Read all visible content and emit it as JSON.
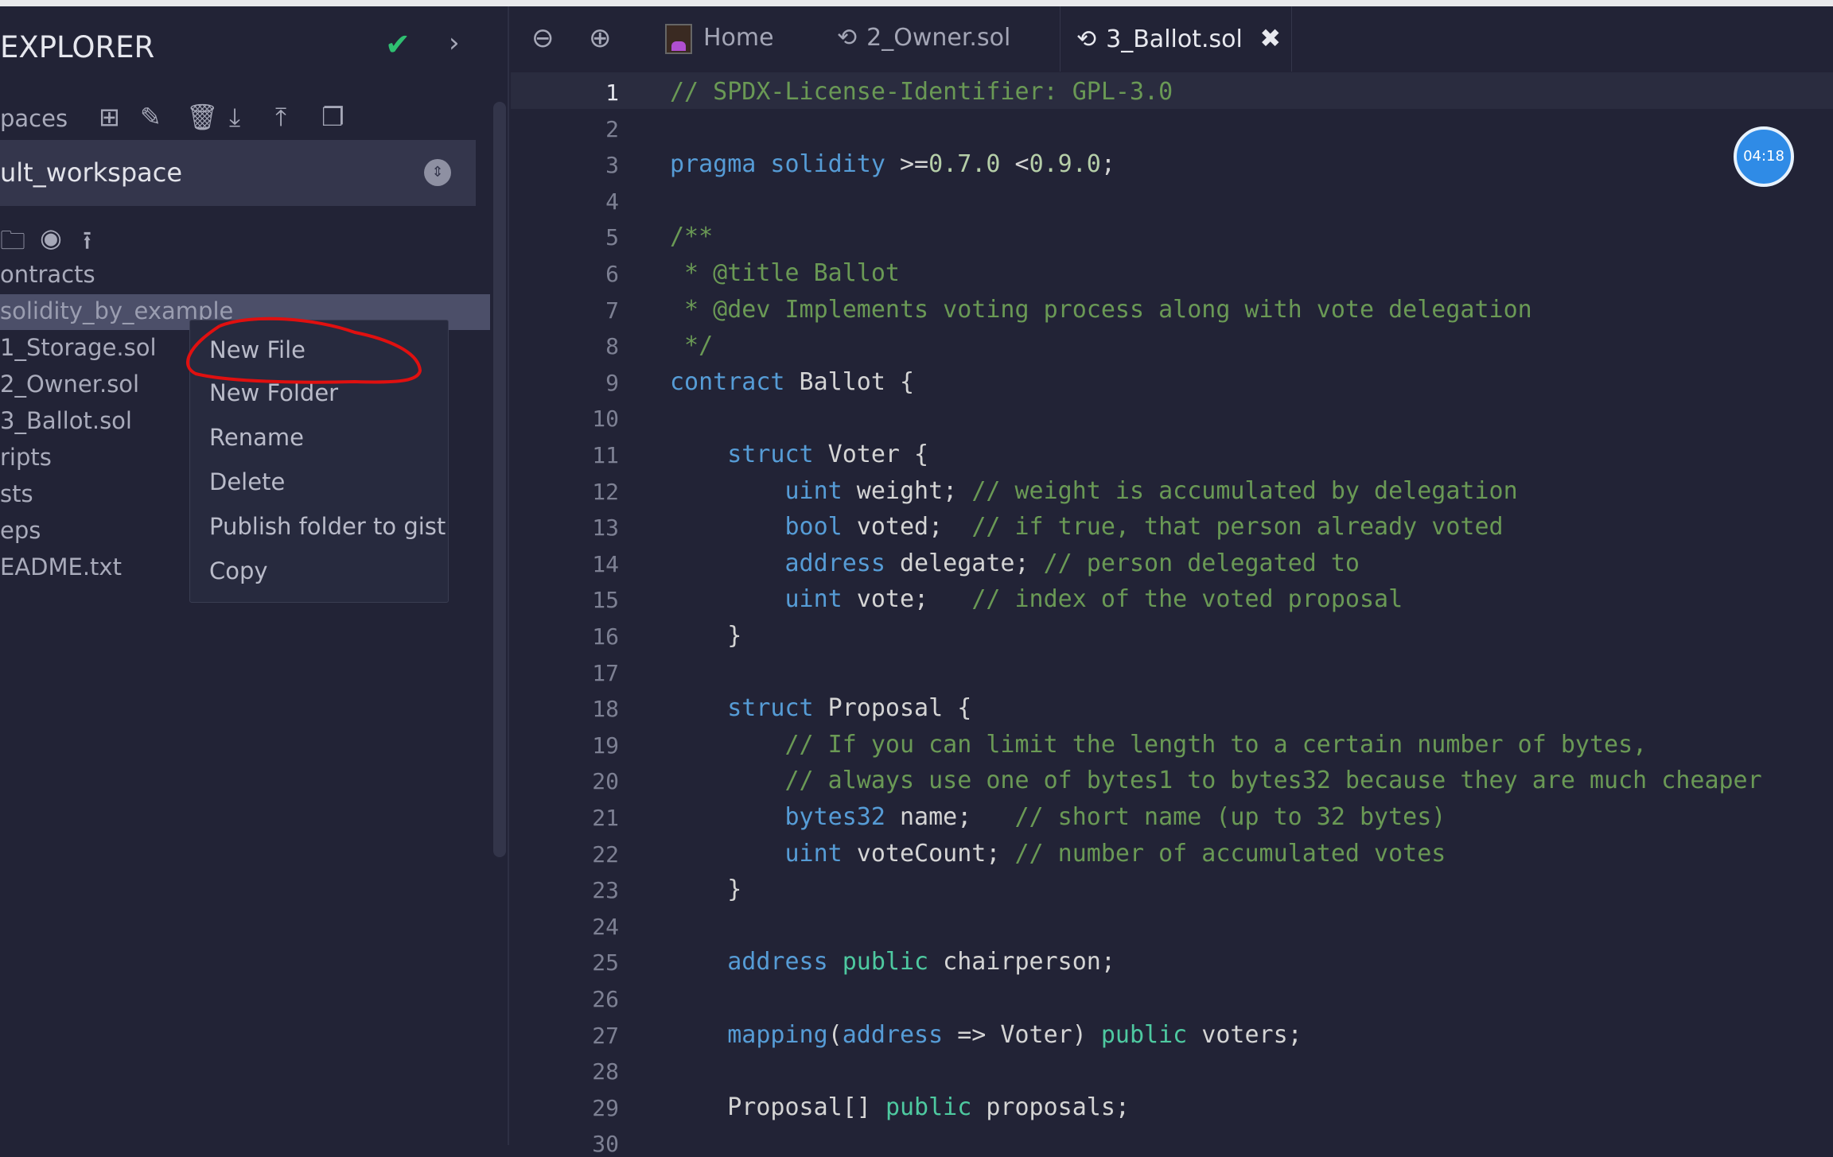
{
  "sidebar": {
    "title": "EXPLORER",
    "workspaces_label": "paces",
    "workspace_selected": "ult_workspace",
    "tree": [
      "ontracts",
      "solidity_by_example",
      "1_Storage.sol",
      "2_Owner.sol",
      "3_Ballot.sol",
      "ripts",
      "sts",
      "eps",
      "EADME.txt"
    ]
  },
  "context_menu": {
    "items": [
      "New File",
      "New Folder",
      "Rename",
      "Delete",
      "Publish folder to gist",
      "Copy"
    ]
  },
  "tabs": [
    {
      "label": "Home"
    },
    {
      "label": "2_Owner.sol"
    },
    {
      "label": "3_Ballot.sol",
      "active": true
    }
  ],
  "timer": "04:18",
  "annotation_color": "#e01010",
  "editor": {
    "current_line": 1,
    "lines": [
      [
        [
          "c",
          "// SPDX-License-Identifier: GPL-3.0"
        ]
      ],
      [],
      [
        [
          "k",
          "pragma solidity"
        ],
        [
          "t",
          " >="
        ],
        [
          "n",
          "0.7.0"
        ],
        [
          "t",
          " <"
        ],
        [
          "n",
          "0.9.0"
        ],
        [
          "t",
          ";"
        ]
      ],
      [],
      [
        [
          "c",
          "/**"
        ]
      ],
      [
        [
          "c",
          " * @title Ballot"
        ]
      ],
      [
        [
          "c",
          " * @dev Implements voting process along with vote delegation"
        ]
      ],
      [
        [
          "c",
          " */"
        ]
      ],
      [
        [
          "k",
          "contract"
        ],
        [
          "t",
          " Ballot {"
        ]
      ],
      [],
      [
        [
          "t",
          "    "
        ],
        [
          "k",
          "struct"
        ],
        [
          "t",
          " Voter {"
        ]
      ],
      [
        [
          "t",
          "        "
        ],
        [
          "k",
          "uint"
        ],
        [
          "t",
          " weight; "
        ],
        [
          "c",
          "// weight is accumulated by delegation"
        ]
      ],
      [
        [
          "t",
          "        "
        ],
        [
          "k",
          "bool"
        ],
        [
          "t",
          " voted;  "
        ],
        [
          "c",
          "// if true, that person already voted"
        ]
      ],
      [
        [
          "t",
          "        "
        ],
        [
          "k",
          "address"
        ],
        [
          "t",
          " delegate; "
        ],
        [
          "c",
          "// person delegated to"
        ]
      ],
      [
        [
          "t",
          "        "
        ],
        [
          "k",
          "uint"
        ],
        [
          "t",
          " vote;   "
        ],
        [
          "c",
          "// index of the voted proposal"
        ]
      ],
      [
        [
          "t",
          "    }"
        ]
      ],
      [],
      [
        [
          "t",
          "    "
        ],
        [
          "k",
          "struct"
        ],
        [
          "t",
          " Proposal {"
        ]
      ],
      [
        [
          "t",
          "        "
        ],
        [
          "c",
          "// If you can limit the length to a certain number of bytes,"
        ]
      ],
      [
        [
          "t",
          "        "
        ],
        [
          "c",
          "// always use one of bytes1 to bytes32 because they are much cheaper"
        ]
      ],
      [
        [
          "t",
          "        "
        ],
        [
          "k",
          "bytes32"
        ],
        [
          "t",
          " name;   "
        ],
        [
          "c",
          "// short name (up to 32 bytes)"
        ]
      ],
      [
        [
          "t",
          "        "
        ],
        [
          "k",
          "uint"
        ],
        [
          "t",
          " voteCount; "
        ],
        [
          "c",
          "// number of accumulated votes"
        ]
      ],
      [
        [
          "t",
          "    }"
        ]
      ],
      [],
      [
        [
          "t",
          "    "
        ],
        [
          "k",
          "address"
        ],
        [
          "t",
          " "
        ],
        [
          "g",
          "public"
        ],
        [
          "t",
          " chairperson;"
        ]
      ],
      [],
      [
        [
          "t",
          "    "
        ],
        [
          "k",
          "mapping"
        ],
        [
          "t",
          "("
        ],
        [
          "k",
          "address"
        ],
        [
          "t",
          " => Voter) "
        ],
        [
          "g",
          "public"
        ],
        [
          "t",
          " voters;"
        ]
      ],
      [],
      [
        [
          "t",
          "    Proposal[] "
        ],
        [
          "g",
          "public"
        ],
        [
          "t",
          " proposals;"
        ]
      ],
      []
    ]
  }
}
